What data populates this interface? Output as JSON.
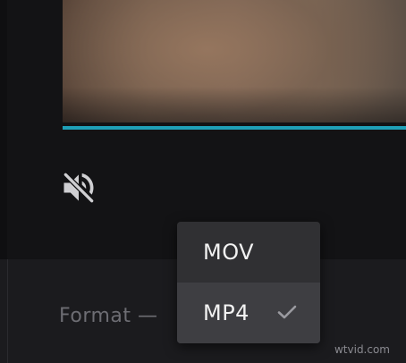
{
  "player": {
    "progress_percent": 100,
    "mute_icon": "volume-mute-icon",
    "accent_color": "#1fa0b8"
  },
  "format_field": {
    "label": "Format —"
  },
  "format_menu": {
    "options": [
      {
        "label": "MOV",
        "selected": false
      },
      {
        "label": "MP4",
        "selected": true
      }
    ],
    "selected_icon": "check-icon"
  },
  "watermark": "wtvid.com"
}
